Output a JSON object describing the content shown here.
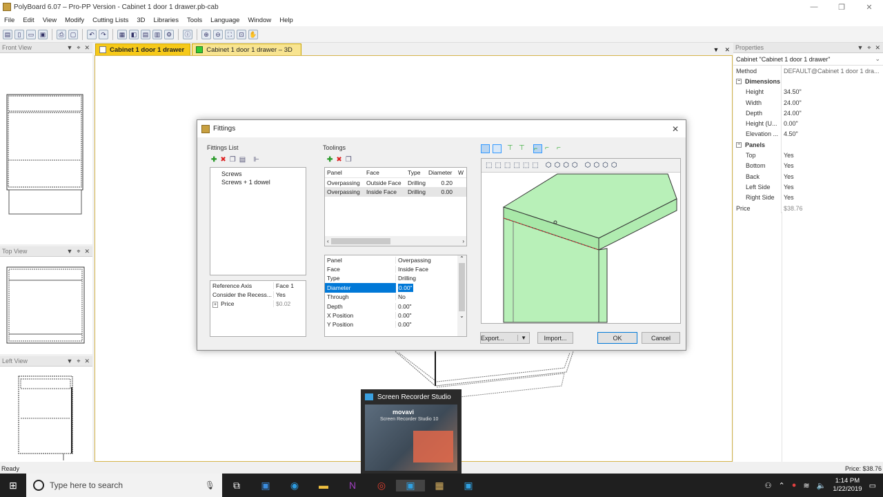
{
  "app": {
    "title": "PolyBoard 6.07 – Pro-PP Version - Cabinet 1 door 1 drawer.pb-cab",
    "window_controls": [
      "—",
      "❐",
      "✕"
    ]
  },
  "menu": [
    "File",
    "Edit",
    "View",
    "Modify",
    "Cutting Lists",
    "3D",
    "Libraries",
    "Tools",
    "Language",
    "Window",
    "Help"
  ],
  "panels": {
    "front": "Front View",
    "top": "Top View",
    "left": "Left View",
    "controls": [
      "▼",
      "⌖",
      "✕"
    ]
  },
  "tabs": [
    {
      "label": "Cabinet 1 door 1 drawer",
      "active": true
    },
    {
      "label": "Cabinet 1 door 1 drawer – 3D",
      "active": false
    }
  ],
  "tab_controls": [
    "▼",
    "✕"
  ],
  "properties": {
    "header": "Properties",
    "object": "Cabinet \"Cabinet 1 door 1 drawer\"",
    "method_label": "Method",
    "method_value": "DEFAULT@Cabinet 1 door 1 dra...",
    "dimensions_label": "Dimensions",
    "dimensions": [
      {
        "k": "Height",
        "v": "34.50\""
      },
      {
        "k": "Width",
        "v": "24.00\""
      },
      {
        "k": "Depth",
        "v": "24.00\""
      },
      {
        "k": "Height (U...",
        "v": "0.00\""
      },
      {
        "k": "Elevation ...",
        "v": "4.50\""
      }
    ],
    "panels_label": "Panels",
    "panels": [
      {
        "k": "Top",
        "v": "Yes"
      },
      {
        "k": "Bottom",
        "v": "Yes"
      },
      {
        "k": "Back",
        "v": "Yes"
      },
      {
        "k": "Left Side",
        "v": "Yes"
      },
      {
        "k": "Right Side",
        "v": "Yes"
      }
    ],
    "price_label": "Price",
    "price_value": "$38.76"
  },
  "dialog": {
    "title": "Fittings",
    "close": "✕",
    "fittings_list_label": "Fittings List",
    "fittings": [
      "Screws",
      "Screws + 1 dowel"
    ],
    "fitting_props": [
      {
        "k": "Reference Axis",
        "v": "Face 1"
      },
      {
        "k": "Consider the Recess...",
        "v": "Yes"
      },
      {
        "k": "Price",
        "v": "$0.02"
      }
    ],
    "toolings_label": "Toolings",
    "tooling_columns": [
      "Panel",
      "Face",
      "Type",
      "Diameter",
      "W"
    ],
    "tooling_rows": [
      [
        "Overpassing",
        "Outside Face",
        "Drilling",
        "0.20"
      ],
      [
        "Overpassing",
        "Inside Face",
        "Drilling",
        "0.00"
      ]
    ],
    "tooling_props": [
      {
        "k": "Panel",
        "v": "Overpassing"
      },
      {
        "k": "Face",
        "v": "Inside Face"
      },
      {
        "k": "Type",
        "v": "Drilling"
      },
      {
        "k": "Diameter",
        "v": "0.00\""
      },
      {
        "k": "Through",
        "v": "No"
      },
      {
        "k": "Depth",
        "v": "0.00\""
      },
      {
        "k": "X Position",
        "v": "0.00\""
      },
      {
        "k": "Y Position",
        "v": "0.00\""
      }
    ],
    "export_label": "Export...",
    "import_label": "Import...",
    "ok_label": "OK",
    "cancel_label": "Cancel"
  },
  "status": {
    "left": "Ready",
    "right": "Price: $38.76"
  },
  "popup": {
    "title": "Screen Recorder Studio",
    "brand": "movavi",
    "subtitle": "Screen Recorder Studio 10"
  },
  "taskbar": {
    "search_placeholder": "Type here to search",
    "time": "1:14 PM",
    "date": "1/22/2019"
  },
  "colors": {
    "tab_active": "#f6c919",
    "tab_inactive": "#f8e490",
    "model_green": "#b8f0b8",
    "selection": "#0078d7"
  }
}
